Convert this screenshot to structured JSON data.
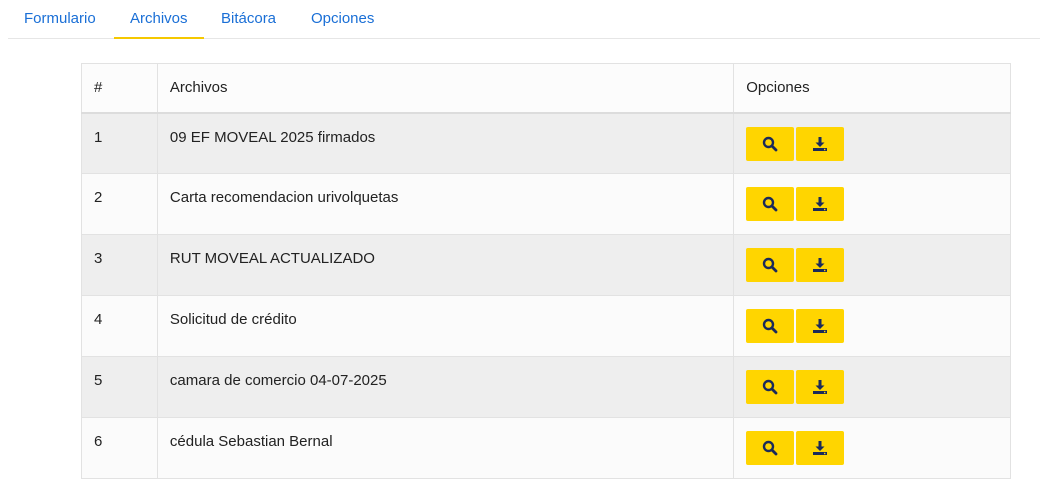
{
  "tabs": [
    {
      "label": "Formulario",
      "active": false
    },
    {
      "label": "Archivos",
      "active": true
    },
    {
      "label": "Bitácora",
      "active": false
    },
    {
      "label": "Opciones",
      "active": false
    }
  ],
  "table": {
    "headers": {
      "num": "#",
      "name": "Archivos",
      "options": "Opciones"
    },
    "rows": [
      {
        "num": "1",
        "name": "09 EF MOVEAL 2025 firmados"
      },
      {
        "num": "2",
        "name": "Carta recomendacion urivolquetas"
      },
      {
        "num": "3",
        "name": "RUT MOVEAL ACTUALIZADO"
      },
      {
        "num": "4",
        "name": "Solicitud de crédito"
      },
      {
        "num": "5",
        "name": "camara de comercio 04-07-2025"
      },
      {
        "num": "6",
        "name": "cédula Sebastian Bernal"
      }
    ]
  },
  "icons": {
    "view": "search-icon",
    "download": "download-icon"
  },
  "colors": {
    "accent": "#ffd500",
    "tab_text": "#1a6fd6",
    "icon": "#1a2a5a"
  }
}
